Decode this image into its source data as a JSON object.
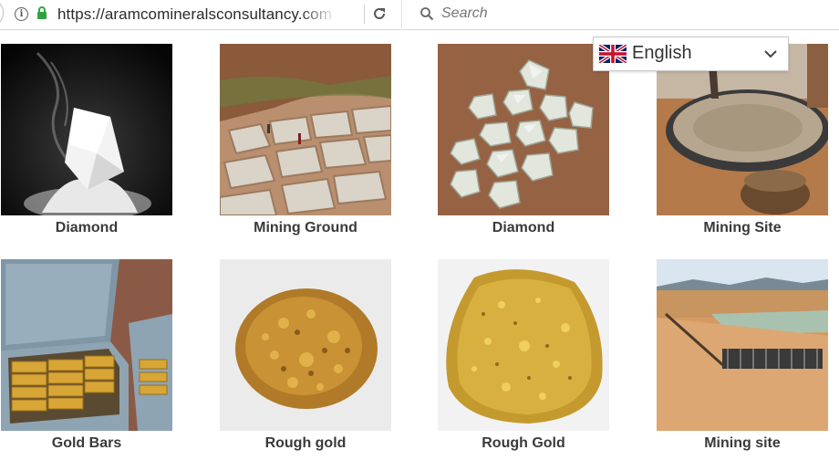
{
  "browser": {
    "url": "https://aramcomineralsconsultancy.com",
    "search_placeholder": "Search"
  },
  "language_selector": {
    "selected": "English",
    "flag_icon": "uk-flag-icon"
  },
  "gallery": [
    {
      "caption": "Diamond"
    },
    {
      "caption": "Mining Ground"
    },
    {
      "caption": "Diamond"
    },
    {
      "caption": "Mining Site"
    },
    {
      "caption": "Gold Bars"
    },
    {
      "caption": "Rough gold"
    },
    {
      "caption": "Rough Gold"
    },
    {
      "caption": "Mining site"
    }
  ],
  "colors": {
    "caption_text": "#3a3a3a",
    "lock_green": "#2fa33f"
  }
}
